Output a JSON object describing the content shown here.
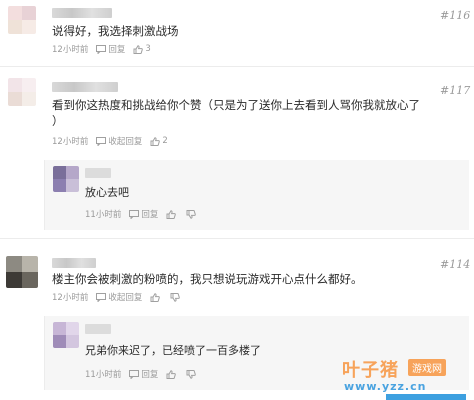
{
  "comments": [
    {
      "floor": "#116",
      "text": "说得好，我选择刺激战场",
      "time": "12小时前",
      "reply_label": "回复",
      "likes": "3"
    },
    {
      "floor": "#117",
      "text_line1": "看到你这热度和挑战给你个赞（只是为了送你上去看到人骂你我就放心了",
      "text_line2": "）",
      "time": "12小时前",
      "reply_label": "收起回复",
      "likes": "2",
      "replies": [
        {
          "text": "放心去吧",
          "time": "11小时前",
          "reply_label": "回复"
        }
      ]
    },
    {
      "floor": "#114",
      "text": "楼主你会被刺激的粉喷的，我只想说玩游戏开心点什么都好。",
      "time": "12小时前",
      "reply_label": "收起回复",
      "replies": [
        {
          "text": "兄弟你来迟了，已经喷了一百多楼了",
          "time": "11小时前",
          "reply_label": "回复"
        }
      ]
    }
  ],
  "watermark": {
    "title": "叶子猪",
    "badge": "游戏网",
    "url": "www.yzz.cn"
  },
  "colors": {
    "accent_orange": "#f7a35a",
    "accent_blue": "#3da0e0",
    "meta_gray": "#9a9a9a"
  }
}
